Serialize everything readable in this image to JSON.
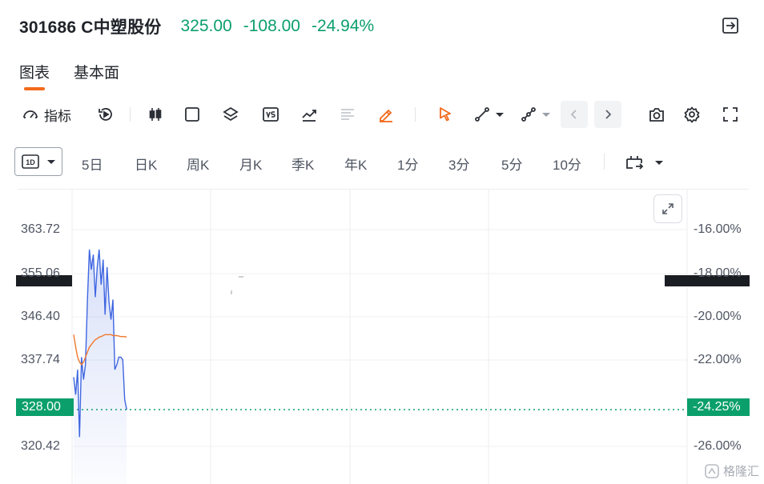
{
  "header": {
    "stock_name": "301686 C中塑股份",
    "price": "325.00",
    "change": "-108.00",
    "change_pct": "-24.94%"
  },
  "tabs": [
    {
      "label": "图表",
      "active": true
    },
    {
      "label": "基本面",
      "active": false
    }
  ],
  "toolbar": {
    "indicator_label": "指标",
    "icons": [
      "gauge-icon",
      "replay-icon",
      "candlestick-icon",
      "square-icon",
      "layers-icon",
      "vs-icon",
      "trend-icon",
      "align-icon",
      "pen-icon",
      "cursor-icon",
      "line-tool-icon",
      "link-tool-icon",
      "chevron-left-icon",
      "chevron-right-icon",
      "camera-icon",
      "gear-icon",
      "fullscreen-icon"
    ]
  },
  "periods": {
    "selected": "1D",
    "items": [
      "5日",
      "日K",
      "周K",
      "月K",
      "季K",
      "年K",
      "1分",
      "3分",
      "5分",
      "10分"
    ]
  },
  "colors": {
    "down": "#0b9f6c",
    "accent": "#f26a1b",
    "price_line": "#3f66e0",
    "avg_line": "#f0782c"
  },
  "axes": {
    "left_ticks": [
      "363.72",
      "355.06",
      "346.40",
      "337.74",
      "328.00",
      "320.42"
    ],
    "right_ticks": [
      "-16.00%",
      "-18.00%",
      "-20.00%",
      "-22.00%",
      "-24.25%",
      "-26.00%"
    ]
  },
  "tags": {
    "left_current": "328.00",
    "right_current": "-24.25%"
  },
  "watermark": "格隆汇",
  "chart_data": {
    "type": "line",
    "title": "",
    "xlabel": "",
    "ylabel": "",
    "ylim": [
      316.0,
      368.0
    ],
    "series": [
      {
        "name": "",
        "values": [
          334.5,
          331.0,
          336.0,
          322.5,
          338.5,
          334.0,
          337.0,
          350.0,
          360.0,
          356.0,
          359.0,
          350.5,
          356.5,
          360.0,
          353.0,
          358.0,
          347.0,
          356.5,
          349.5,
          346.0,
          350.0,
          336.0,
          337.0,
          338.5,
          338.5,
          338.0,
          330.0,
          328.0
        ]
      },
      {
        "name": "",
        "values": [
          343.0,
          340.5,
          338.5,
          337.5,
          337.0,
          337.5,
          338.5,
          339.5,
          340.5,
          341.0,
          341.5,
          342.0,
          342.2,
          342.5,
          342.6,
          342.8,
          343.0,
          343.0,
          343.0,
          343.0,
          342.8,
          342.8,
          342.8,
          342.7,
          342.6,
          342.6,
          342.6,
          342.5
        ]
      }
    ],
    "reference_value": 328.0
  }
}
